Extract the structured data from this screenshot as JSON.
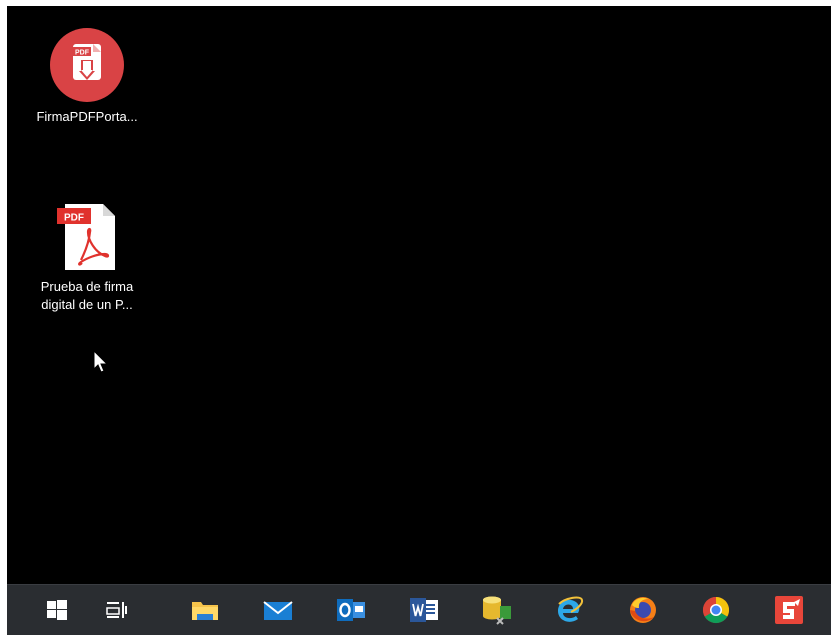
{
  "desktop": {
    "icons": [
      {
        "label": "FirmaPDFPorta..."
      },
      {
        "label_line1": "Prueba de firma",
        "label_line2": "digital de un P..."
      }
    ],
    "firma_badge": "PDF",
    "pdf_badge": "PDF"
  },
  "colors": {
    "desktop_bg": "#000000",
    "taskbar_bg": "#2a2d31",
    "firma_red": "#d94345",
    "pdf_red": "#e0322d"
  },
  "taskbar": {
    "items": [
      {
        "icon": "windows-start-icon"
      },
      {
        "icon": "task-view-icon"
      },
      {
        "icon": "file-explorer-icon"
      },
      {
        "icon": "mail-icon"
      },
      {
        "icon": "outlook-icon"
      },
      {
        "icon": "word-icon"
      },
      {
        "icon": "database-tool-icon"
      },
      {
        "icon": "internet-explorer-icon"
      },
      {
        "icon": "firefox-icon"
      },
      {
        "icon": "chrome-icon"
      },
      {
        "icon": "red-app-icon"
      }
    ]
  }
}
